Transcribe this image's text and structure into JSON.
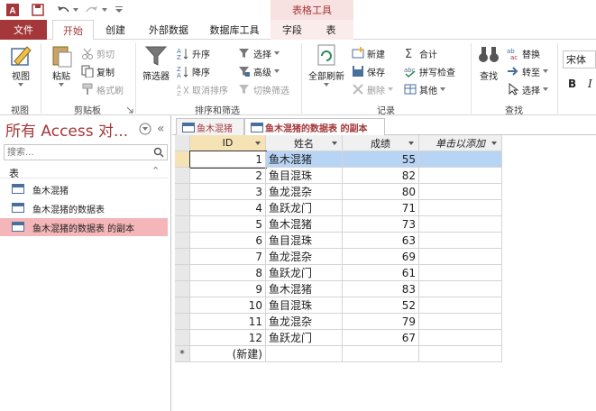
{
  "app": {
    "context_tab_group": "表格工具"
  },
  "ribbon_tabs": [
    "文件",
    "开始",
    "创建",
    "外部数据",
    "数据库工具",
    "字段",
    "表"
  ],
  "ribbon": {
    "view": {
      "label": "视图",
      "group": "视图"
    },
    "clipboard": {
      "paste": "粘贴",
      "cut": "剪切",
      "copy": "复制",
      "format_painter": "格式刷",
      "group": "剪贴板"
    },
    "sort_filter": {
      "filter": "筛选器",
      "asc": "升序",
      "desc": "降序",
      "remove_sort": "取消排序",
      "selection": "选择",
      "advanced": "高级",
      "toggle_filter": "切换筛选",
      "group": "排序和筛选"
    },
    "records": {
      "refresh_all": "全部刷新",
      "new": "新建",
      "save": "保存",
      "delete": "删除",
      "totals": "合计",
      "spelling": "拼写检查",
      "more": "其他",
      "group": "记录"
    },
    "find": {
      "find": "查找",
      "replace": "替换",
      "goto": "转至",
      "select": "选择",
      "group": "查找"
    },
    "font": {
      "font_name": "宋体",
      "bold": "B",
      "italic": "I"
    }
  },
  "nav": {
    "title": "所有 Access 对...",
    "search_placeholder": "搜索...",
    "section": "表",
    "items": [
      "鱼木混猪",
      "鱼木混猪的数据表",
      "鱼木混猪的数据表 的副本"
    ],
    "selected_index": 2
  },
  "doc_tabs": [
    "鱼木混猪",
    "鱼木混猪的数据表 的副本"
  ],
  "table": {
    "columns": [
      "ID",
      "姓名",
      "成绩",
      "单击以添加"
    ],
    "rows": [
      [
        "1",
        "鱼木混猪",
        "55"
      ],
      [
        "2",
        "鱼目混珠",
        "82"
      ],
      [
        "3",
        "鱼龙混杂",
        "80"
      ],
      [
        "4",
        "鱼跃龙门",
        "71"
      ],
      [
        "5",
        "鱼木混猪",
        "73"
      ],
      [
        "6",
        "鱼目混珠",
        "63"
      ],
      [
        "7",
        "鱼龙混杂",
        "69"
      ],
      [
        "8",
        "鱼跃龙门",
        "61"
      ],
      [
        "9",
        "鱼木混猪",
        "83"
      ],
      [
        "10",
        "鱼目混珠",
        "52"
      ],
      [
        "11",
        "鱼龙混杂",
        "79"
      ],
      [
        "12",
        "鱼跃龙门",
        "67"
      ]
    ],
    "new_row_marker": "*",
    "new_row_label": "(新建)"
  },
  "colors": {
    "brand": "#a4373a",
    "selected_row": "#b7d4f5",
    "nav_selected": "#f4b6b8"
  }
}
